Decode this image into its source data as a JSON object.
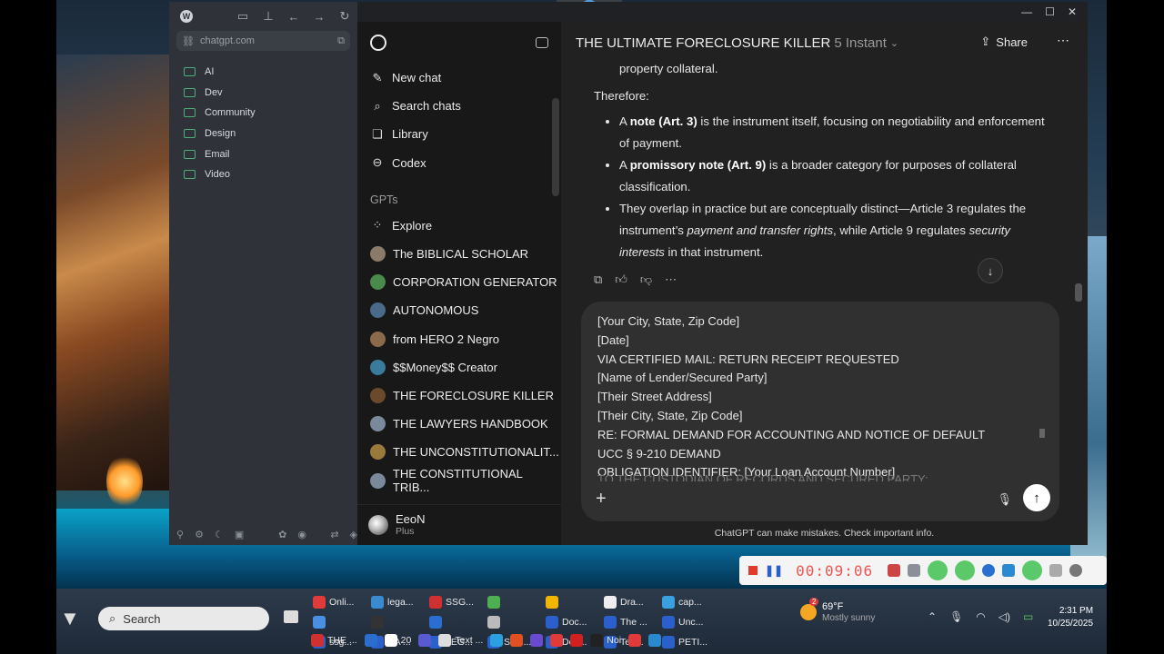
{
  "left_panel": {
    "url": "chatgpt.com",
    "folders": [
      "AI",
      "Dev",
      "Community",
      "Design",
      "Email",
      "Video"
    ]
  },
  "sidebar": {
    "items": [
      {
        "label": "New chat",
        "icon": "edit-icon"
      },
      {
        "label": "Search chats",
        "icon": "search-icon"
      },
      {
        "label": "Library",
        "icon": "library-icon"
      },
      {
        "label": "Codex",
        "icon": "codex-icon"
      }
    ],
    "gpts_heading": "GPTs",
    "gpts": [
      {
        "label": "Explore",
        "icon": "explore-icon"
      },
      {
        "label": "The BIBLICAL SCHOLAR",
        "color": "#8a7a6a"
      },
      {
        "label": "CORPORATION GENERATOR",
        "color": "#4a8a4a"
      },
      {
        "label": "AUTONOMOUS",
        "color": "#4a6a8a"
      },
      {
        "label": "from HERO 2 Negro",
        "color": "#8a6a4a"
      },
      {
        "label": "$$Money$$ Creator",
        "color": "#3a7a9a"
      },
      {
        "label": "THE FORECLOSURE KILLER",
        "color": "#6a4a2a"
      },
      {
        "label": "THE LAWYERS HANDBOOK",
        "color": "#7a8a9a"
      },
      {
        "label": "THE UNCONSTITUTIONALIT...",
        "color": "#9a7a3a"
      },
      {
        "label": "THE CONSTITUTIONAL TRIB...",
        "color": "#7a8a9a"
      }
    ],
    "user": {
      "name": "EeoN",
      "plan": "Plus"
    }
  },
  "main": {
    "title": "THE ULTIMATE FORECLOSURE KILLER",
    "model": "5 Instant",
    "share_label": "Share",
    "cont_line": "property collateral.",
    "therefore": "Therefore:",
    "bullets": [
      {
        "pre": "A ",
        "bold": "note (Art. 3)",
        "post": " is the instrument itself, focusing on negotiability and enforcement of payment."
      },
      {
        "pre": "A ",
        "bold": "promissory note (Art. 9)",
        "post": " is a broader category for purposes of collateral classification."
      },
      {
        "pre": "They overlap in practice but are conceptually distinct—Article 3 regulates the instrument’s ",
        "italic1": "payment and transfer rights",
        "mid": ", while Article 9 regulates ",
        "italic2": "security interests",
        "post": " in that instrument."
      }
    ],
    "composer_lines": [
      "[Your City, State, Zip Code]",
      "[Date]",
      "VIA CERTIFIED MAIL: RETURN RECEIPT REQUESTED",
      "[Name of Lender/Secured Party]",
      "[Their Street Address]",
      "[Their City, State, Zip Code]",
      "RE: FORMAL DEMAND FOR ACCOUNTING AND NOTICE OF DEFAULT",
      "UCC § 9-210 DEMAND",
      "OBLIGATION IDENTIFIER: [Your Loan Account Number]"
    ],
    "composer_faded": "TO THE CUSTODIAN OF RECORDS AND SECURED PARTY:",
    "disclaimer": "ChatGPT can make mistakes. Check important info."
  },
  "recorder": {
    "timer": "00:09:06"
  },
  "taskbar": {
    "search": "Search",
    "apps": [
      {
        "label": "Onli...",
        "color": "#e03a3a"
      },
      {
        "label": "lega...",
        "color": "#3a8ad0"
      },
      {
        "label": "SSG...",
        "color": "#d03030"
      },
      {
        "label": "",
        "color": "#4caf50"
      },
      {
        "label": "",
        "color": "#f2b600"
      },
      {
        "label": "Dra...",
        "color": "#eee"
      },
      {
        "label": "cap...",
        "color": "#3aa0e0"
      },
      {
        "label": "",
        "color": "#4a90e2"
      },
      {
        "label": "",
        "color": "#333"
      },
      {
        "label": "",
        "color": "#2a6fd0"
      },
      {
        "label": "",
        "color": "#bbb"
      },
      {
        "label": "Doc...",
        "color": "#2b5fc9"
      },
      {
        "label": "The ...",
        "color": "#2b5fc9"
      },
      {
        "label": "Unc...",
        "color": "#2b5fc9"
      },
      {
        "label": "ssg...",
        "color": "#2b5fc9"
      },
      {
        "label": "CA ...",
        "color": "#2b5fc9"
      },
      {
        "label": "LEG...",
        "color": "#2b5fc9"
      },
      {
        "label": "Sum...",
        "color": "#2b5fc9"
      },
      {
        "label": "Doc...",
        "color": "#2b5fc9"
      },
      {
        "label": "Ten...",
        "color": "#2b5fc9"
      },
      {
        "label": "PETI...",
        "color": "#2b5fc9"
      }
    ],
    "bottom_apps": [
      {
        "label": "THE ...",
        "color": "#d03030"
      },
      {
        "label": "",
        "color": "#2a6fd0"
      },
      {
        "label": "20",
        "color": "#fff"
      },
      {
        "label": "",
        "color": "#5a5ad0"
      },
      {
        "label": "Text ...",
        "color": "#ddd"
      },
      {
        "label": "",
        "color": "#2aa0e0"
      },
      {
        "label": "",
        "color": "#e05020"
      },
      {
        "label": "",
        "color": "#6a4ad0"
      },
      {
        "label": "",
        "color": "#e03a3a"
      },
      {
        "label": "",
        "color": "#d02020"
      },
      {
        "label": "Noi",
        "color": "#222"
      },
      {
        "label": "",
        "color": "#e03a3a"
      },
      {
        "label": "",
        "color": "#2a8ad0"
      }
    ],
    "weather": {
      "temp": "69°F",
      "desc": "Mostly sunny",
      "badge": "2"
    },
    "time": "2:31 PM",
    "date": "10/25/2025"
  }
}
